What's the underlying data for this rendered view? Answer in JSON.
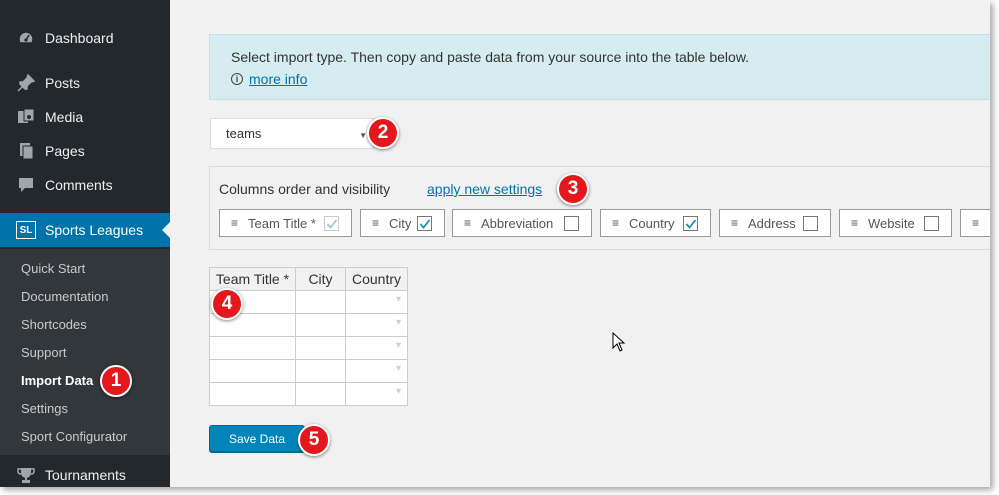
{
  "sidebar": {
    "items": [
      {
        "label": "Dashboard",
        "icon": "dashboard-icon"
      },
      {
        "label": "Posts",
        "icon": "pin-icon"
      },
      {
        "label": "Media",
        "icon": "media-icon"
      },
      {
        "label": "Pages",
        "icon": "pages-icon"
      },
      {
        "label": "Comments",
        "icon": "comments-icon"
      },
      {
        "label": "Sports Leagues",
        "icon": "sl-icon",
        "icon_text": "SL"
      },
      {
        "label": "Tournaments",
        "icon": "trophy-icon"
      }
    ],
    "submenu": [
      "Quick Start",
      "Documentation",
      "Shortcodes",
      "Support",
      "Import Data",
      "Settings",
      "Sport Configurator"
    ],
    "current_sub": "Import Data"
  },
  "notice": {
    "text": "Select import type. Then copy and paste data from your source into the table below.",
    "info_symbol": "i",
    "link": "more info"
  },
  "type_select": {
    "value": "teams"
  },
  "columns": {
    "title": "Columns order and visibility",
    "apply_link": "apply new settings",
    "chips": [
      {
        "label": "Team Title *",
        "checked": true,
        "disabled": true
      },
      {
        "label": "City",
        "checked": true
      },
      {
        "label": "Abbreviation",
        "checked": false
      },
      {
        "label": "Country",
        "checked": true
      },
      {
        "label": "Address",
        "checked": false
      },
      {
        "label": "Website",
        "checked": false
      }
    ]
  },
  "table": {
    "headers": [
      "Team Title *",
      "City",
      "Country"
    ],
    "rows": 5
  },
  "save_button": "Save Data",
  "badges": [
    "1",
    "2",
    "3",
    "4",
    "5"
  ],
  "colors": {
    "sidebar_bg": "#23282d",
    "accent": "#0073aa",
    "badge": "#e4171c",
    "notice_bg": "#d5ecf0"
  }
}
